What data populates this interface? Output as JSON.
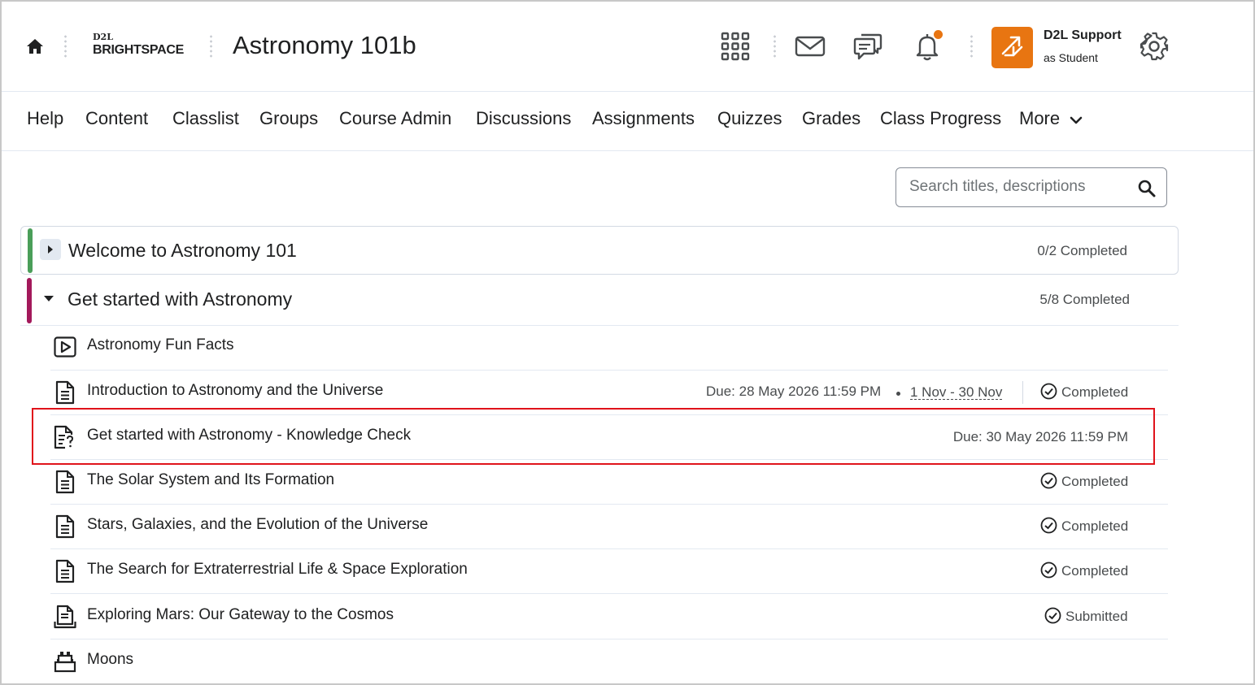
{
  "header": {
    "logo_top": "D2L",
    "logo_brand": "BRIGHTSPACE",
    "course_title": "Astronomy 101b",
    "user_name": "D2L Support",
    "user_role": "as Student",
    "accent_color": "#e87511"
  },
  "nav": {
    "items": [
      "Help",
      "Content",
      "Classlist",
      "Groups",
      "Course Admin",
      "Discussions",
      "Assignments",
      "Quizzes",
      "Grades",
      "Class Progress"
    ],
    "more_label": "More"
  },
  "search": {
    "placeholder": "Search titles, descriptions"
  },
  "modules": [
    {
      "title": "Welcome to Astronomy 101",
      "progress": "0/2 Completed",
      "expanded": false,
      "color": "#4a9e59"
    },
    {
      "title": "Get started with Astronomy",
      "progress": "5/8 Completed",
      "expanded": true,
      "color": "#a3195b",
      "items": [
        {
          "title": "Astronomy Fun Facts",
          "icon": "video-icon"
        },
        {
          "title": "Introduction to Astronomy and the Universe",
          "icon": "document-icon",
          "due": "Due: 28 May 2026 11:59 PM",
          "range": "1 Nov - 30 Nov",
          "status": "Completed"
        },
        {
          "title": "Get started with Astronomy - Knowledge Check",
          "icon": "quiz-icon",
          "due": "Due: 30 May 2026 11:59 PM"
        },
        {
          "title": "The Solar System and Its Formation",
          "icon": "document-icon",
          "status": "Completed"
        },
        {
          "title": "Stars, Galaxies, and the Evolution of the Universe",
          "icon": "document-icon",
          "status": "Completed"
        },
        {
          "title": "The Search for Extraterrestrial Life & Space Exploration",
          "icon": "document-icon",
          "status": "Completed"
        },
        {
          "title": "Exploring Mars: Our Gateway to the Cosmos",
          "icon": "assignment-icon",
          "status": "Submitted"
        },
        {
          "title": "Moons",
          "icon": "lego-blocks-icon"
        }
      ]
    }
  ]
}
